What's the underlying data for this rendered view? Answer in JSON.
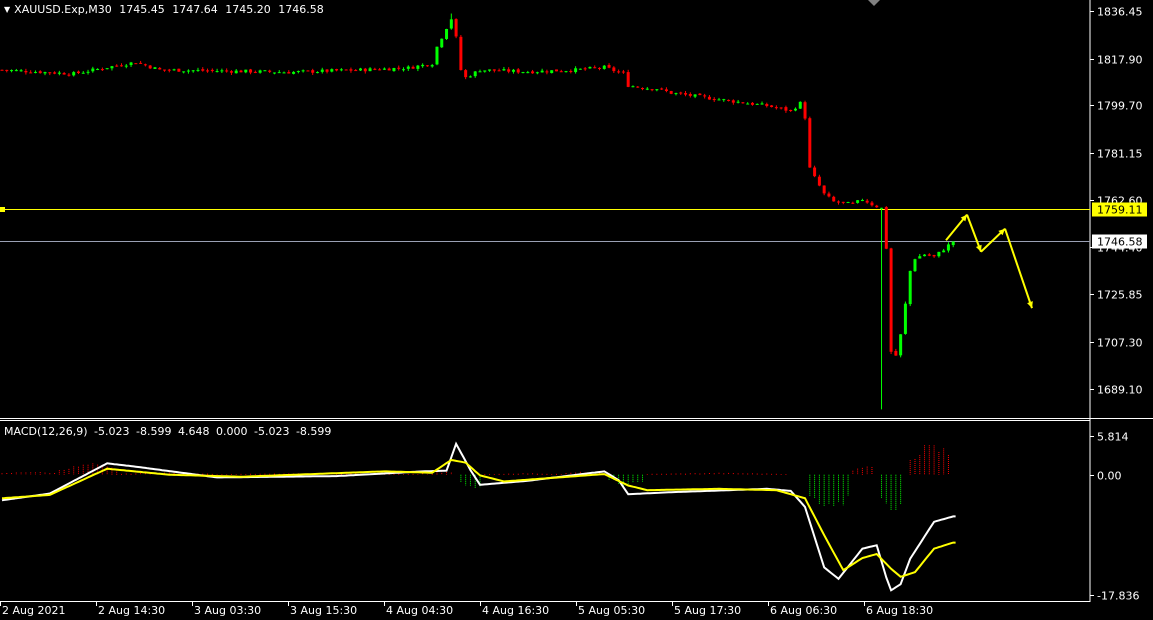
{
  "header": {
    "symbol": "XAUUSD.Exp,M30",
    "open": "1745.45",
    "high": "1747.64",
    "low": "1745.20",
    "close": "1746.58"
  },
  "macd_header": {
    "name": "MACD(12,26,9)",
    "values": [
      "-5.023",
      "-8.599",
      "4.648",
      "0.000",
      "-5.023",
      "-8.599"
    ]
  },
  "colors": {
    "background": "#000000",
    "bull": "#00ff00",
    "bear": "#ff0000",
    "level_line": "#ffff00",
    "price_line": "#9aa0b4",
    "macd_main": "#ffffff",
    "macd_signal": "#ffff00",
    "hist_pos": "#ff0000",
    "hist_neg": "#00ff00",
    "axis": "#ffffff"
  },
  "chart_data": [
    {
      "type": "candlestick",
      "symbol": "XAUUSD.Exp",
      "timeframe": "M30",
      "ylim": [
        1678,
        1840
      ],
      "y_ticks": [
        "1836.45",
        "1817.90",
        "1799.70",
        "1781.15",
        "1762.60",
        "1744.40",
        "1725.85",
        "1707.30",
        "1689.10"
      ],
      "x_ticks": [
        "2 Aug 2021",
        "2 Aug 14:30",
        "3 Aug 03:30",
        "3 Aug 15:30",
        "4 Aug 04:30",
        "4 Aug 16:30",
        "5 Aug 05:30",
        "5 Aug 17:30",
        "6 Aug 06:30",
        "6 Aug 18:30"
      ],
      "horizontal_levels": [
        {
          "value": "1759.11",
          "kind": "level"
        },
        {
          "value": "1746.58",
          "kind": "current-price"
        }
      ],
      "candle_count": 200,
      "close_path": [
        [
          0,
          1813.5
        ],
        [
          15,
          1812.0
        ],
        [
          22,
          1814.5
        ],
        [
          28,
          1816.5
        ],
        [
          33,
          1813.5
        ],
        [
          40,
          1813.3
        ],
        [
          55,
          1812.8
        ],
        [
          60,
          1812.6
        ],
        [
          75,
          1813.5
        ],
        [
          85,
          1814.3
        ],
        [
          90,
          1816.0
        ],
        [
          91,
          1822.5
        ],
        [
          93,
          1830.0
        ],
        [
          94,
          1833.5
        ],
        [
          95,
          1826.0
        ],
        [
          96,
          1813.5
        ],
        [
          97,
          1810.5
        ],
        [
          100,
          1813.5
        ],
        [
          110,
          1812.8
        ],
        [
          120,
          1813.5
        ],
        [
          126,
          1814.5
        ],
        [
          130,
          1812.0
        ],
        [
          131,
          1807.5
        ],
        [
          134,
          1806.5
        ],
        [
          137,
          1806.2
        ],
        [
          140,
          1804.5
        ],
        [
          150,
          1802.0
        ],
        [
          160,
          1799.5
        ],
        [
          165,
          1797.5
        ],
        [
          167,
          1800.5
        ],
        [
          168,
          1795.0
        ],
        [
          169,
          1775.0
        ],
        [
          170,
          1771.5
        ],
        [
          172,
          1765.0
        ],
        [
          174,
          1762.0
        ],
        [
          178,
          1761.0
        ],
        [
          180,
          1763.0
        ],
        [
          182,
          1761.0
        ],
        [
          184,
          1759.5
        ],
        [
          185,
          1744.0
        ],
        [
          186,
          1703.5
        ],
        [
          187,
          1702.0
        ],
        [
          188,
          1710.0
        ],
        [
          189,
          1722.0
        ],
        [
          190,
          1735.0
        ],
        [
          191,
          1740.0
        ],
        [
          193,
          1741.5
        ],
        [
          195,
          1740.5
        ],
        [
          197,
          1743.5
        ],
        [
          199,
          1746.58
        ]
      ],
      "wicks": [
        {
          "index": 184,
          "low": 1681.0
        },
        {
          "index": 94,
          "high": 1835.5
        }
      ],
      "projection": [
        [
          1747.0,
          1757.0
        ],
        [
          1757.0,
          1742.5
        ],
        [
          1742.5,
          1751.5
        ],
        [
          1751.5,
          1720.5
        ]
      ]
    },
    {
      "type": "macd",
      "name": "MACD(12,26,9)",
      "ylim": [
        -18.5,
        8
      ],
      "y_ticks": [
        "5.814",
        "0.00",
        "-17.836"
      ],
      "main_path": [
        [
          0,
          -3.8
        ],
        [
          10,
          -2.8
        ],
        [
          22,
          1.7
        ],
        [
          28,
          1.2
        ],
        [
          45,
          -0.4
        ],
        [
          70,
          -0.2
        ],
        [
          88,
          0.5
        ],
        [
          93,
          0.6
        ],
        [
          95,
          4.6
        ],
        [
          98,
          0.7
        ],
        [
          100,
          -1.5
        ],
        [
          110,
          -0.9
        ],
        [
          126,
          0.5
        ],
        [
          129,
          -0.8
        ],
        [
          131,
          -2.9
        ],
        [
          140,
          -2.6
        ],
        [
          160,
          -2.1
        ],
        [
          165,
          -2.4
        ],
        [
          168,
          -4.8
        ],
        [
          172,
          -13.8
        ],
        [
          175,
          -15.5
        ],
        [
          180,
          -11.0
        ],
        [
          183,
          -10.5
        ],
        [
          185,
          -15.3
        ],
        [
          186,
          -17.2
        ],
        [
          188,
          -16.3
        ],
        [
          190,
          -12.5
        ],
        [
          195,
          -7.0
        ],
        [
          199,
          -6.2
        ]
      ],
      "signal_path": [
        [
          0,
          -3.5
        ],
        [
          10,
          -3.0
        ],
        [
          22,
          0.9
        ],
        [
          35,
          0.0
        ],
        [
          50,
          -0.3
        ],
        [
          80,
          0.5
        ],
        [
          90,
          0.3
        ],
        [
          94,
          2.2
        ],
        [
          97,
          1.8
        ],
        [
          100,
          -0.1
        ],
        [
          105,
          -1.0
        ],
        [
          126,
          0.1
        ],
        [
          131,
          -1.6
        ],
        [
          135,
          -2.3
        ],
        [
          150,
          -2.1
        ],
        [
          162,
          -2.3
        ],
        [
          168,
          -3.5
        ],
        [
          172,
          -9.0
        ],
        [
          176,
          -14.2
        ],
        [
          180,
          -12.4
        ],
        [
          183,
          -11.8
        ],
        [
          186,
          -14.0
        ],
        [
          188,
          -15.2
        ],
        [
          191,
          -14.5
        ],
        [
          195,
          -11.0
        ],
        [
          199,
          -10.1
        ]
      ],
      "histogram_regions": [
        {
          "from": 0,
          "to": 12,
          "value": 0.4
        },
        {
          "from": 12,
          "to": 25,
          "value": 1.5
        },
        {
          "from": 25,
          "to": 45,
          "value": 0.3
        },
        {
          "from": 45,
          "to": 88,
          "value": 0.2
        },
        {
          "from": 88,
          "to": 95,
          "value": 0.5
        },
        {
          "from": 96,
          "to": 101,
          "value": -2.2
        },
        {
          "from": 101,
          "to": 118,
          "value": 0.2
        },
        {
          "from": 118,
          "to": 126,
          "value": 0.4
        },
        {
          "from": 127,
          "to": 135,
          "value": -1.6
        },
        {
          "from": 135,
          "to": 165,
          "value": 0.25
        },
        {
          "from": 169,
          "to": 178,
          "value": -5.5
        },
        {
          "from": 178,
          "to": 183,
          "value": 1.3
        },
        {
          "from": 184,
          "to": 189,
          "value": -6.8
        },
        {
          "from": 190,
          "to": 199,
          "value": 4.6
        }
      ]
    }
  ]
}
